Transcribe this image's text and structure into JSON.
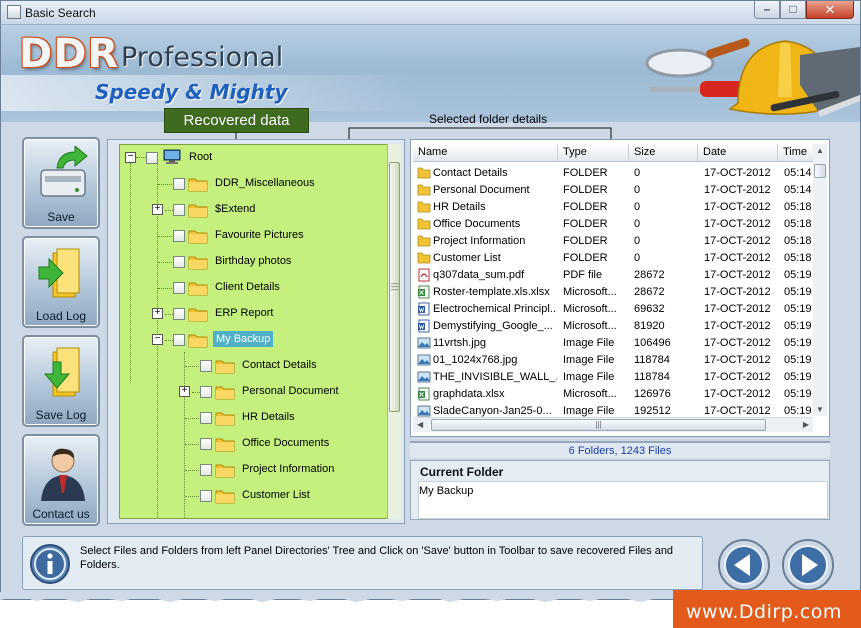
{
  "window": {
    "title": "Basic Search"
  },
  "banner": {
    "logo_ddr": "DDR",
    "logo_professional": "Professional",
    "tagline": "Speedy & Mighty"
  },
  "toolbar": [
    {
      "label": "Save",
      "icon": "save-disk-icon"
    },
    {
      "label": "Load Log",
      "icon": "load-log-icon"
    },
    {
      "label": "Save Log",
      "icon": "save-log-icon"
    },
    {
      "label": "Contact us",
      "icon": "contact-person-icon"
    }
  ],
  "callouts": {
    "recovered": "Recovered data",
    "selected": "Selected folder details"
  },
  "tree": {
    "root": "Root",
    "items": [
      {
        "label": "DDR_Miscellaneous",
        "expander": ""
      },
      {
        "label": "$Extend",
        "expander": "+"
      },
      {
        "label": "Favourite Pictures",
        "expander": ""
      },
      {
        "label": "Birthday photos",
        "expander": ""
      },
      {
        "label": "Client Details",
        "expander": ""
      },
      {
        "label": "ERP Report",
        "expander": "+"
      },
      {
        "label": "My Backup",
        "expander": "−",
        "selected": true
      }
    ],
    "children": [
      {
        "label": "Contact Details",
        "expander": ""
      },
      {
        "label": "Personal Document",
        "expander": "+"
      },
      {
        "label": "HR Details",
        "expander": ""
      },
      {
        "label": "Office Documents",
        "expander": ""
      },
      {
        "label": "Project Information",
        "expander": ""
      },
      {
        "label": "Customer List",
        "expander": ""
      }
    ]
  },
  "list": {
    "columns": [
      "Name",
      "Type",
      "Size",
      "Date",
      "Time"
    ],
    "rows": [
      {
        "icon": "folder",
        "name": "Contact Details",
        "type": "FOLDER",
        "size": "0",
        "date": "17-OCT-2012",
        "time": "05:14"
      },
      {
        "icon": "folder",
        "name": "Personal Document",
        "type": "FOLDER",
        "size": "0",
        "date": "17-OCT-2012",
        "time": "05:14"
      },
      {
        "icon": "folder",
        "name": "HR Details",
        "type": "FOLDER",
        "size": "0",
        "date": "17-OCT-2012",
        "time": "05:18"
      },
      {
        "icon": "folder",
        "name": "Office Documents",
        "type": "FOLDER",
        "size": "0",
        "date": "17-OCT-2012",
        "time": "05:18"
      },
      {
        "icon": "folder",
        "name": "Project Information",
        "type": "FOLDER",
        "size": "0",
        "date": "17-OCT-2012",
        "time": "05:18"
      },
      {
        "icon": "folder",
        "name": "Customer List",
        "type": "FOLDER",
        "size": "0",
        "date": "17-OCT-2012",
        "time": "05:18"
      },
      {
        "icon": "pdf",
        "name": "q307data_sum.pdf",
        "type": "PDF file",
        "size": "28672",
        "date": "17-OCT-2012",
        "time": "05:19"
      },
      {
        "icon": "excel",
        "name": "Roster-template.xls.xlsx",
        "type": "Microsoft...",
        "size": "28672",
        "date": "17-OCT-2012",
        "time": "05:19"
      },
      {
        "icon": "word",
        "name": "Electrochemical Principl...",
        "type": "Microsoft...",
        "size": "69632",
        "date": "17-OCT-2012",
        "time": "05:19"
      },
      {
        "icon": "word",
        "name": "Demystifying_Google_...",
        "type": "Microsoft...",
        "size": "81920",
        "date": "17-OCT-2012",
        "time": "05:19"
      },
      {
        "icon": "image",
        "name": "11vrtsh.jpg",
        "type": "Image File",
        "size": "106496",
        "date": "17-OCT-2012",
        "time": "05:19"
      },
      {
        "icon": "image",
        "name": "01_1024x768.jpg",
        "type": "Image File",
        "size": "118784",
        "date": "17-OCT-2012",
        "time": "05:19"
      },
      {
        "icon": "image",
        "name": "THE_INVISIBLE_WALL_...",
        "type": "Image File",
        "size": "118784",
        "date": "17-OCT-2012",
        "time": "05:19"
      },
      {
        "icon": "excel",
        "name": "graphdata.xlsx",
        "type": "Microsoft...",
        "size": "126976",
        "date": "17-OCT-2012",
        "time": "05:19"
      },
      {
        "icon": "image",
        "name": "SladeCanyon-Jan25-0...",
        "type": "Image File",
        "size": "192512",
        "date": "17-OCT-2012",
        "time": "05:19"
      }
    ]
  },
  "summary": "6 Folders, 1243 Files",
  "current_folder": {
    "heading": "Current Folder",
    "value": "My Backup"
  },
  "status": {
    "message": "Select Files and Folders from left Panel Directories' Tree and Click on 'Save' button in Toolbar to save recovered Files and Folders."
  },
  "footer": {
    "website": "www.Ddirp.com"
  },
  "colors": {
    "tree_bg": "#c5f07d",
    "callout_bg": "#3f6b20",
    "selection": "#4fb0c8",
    "brand_orange": "#e45a1a"
  }
}
